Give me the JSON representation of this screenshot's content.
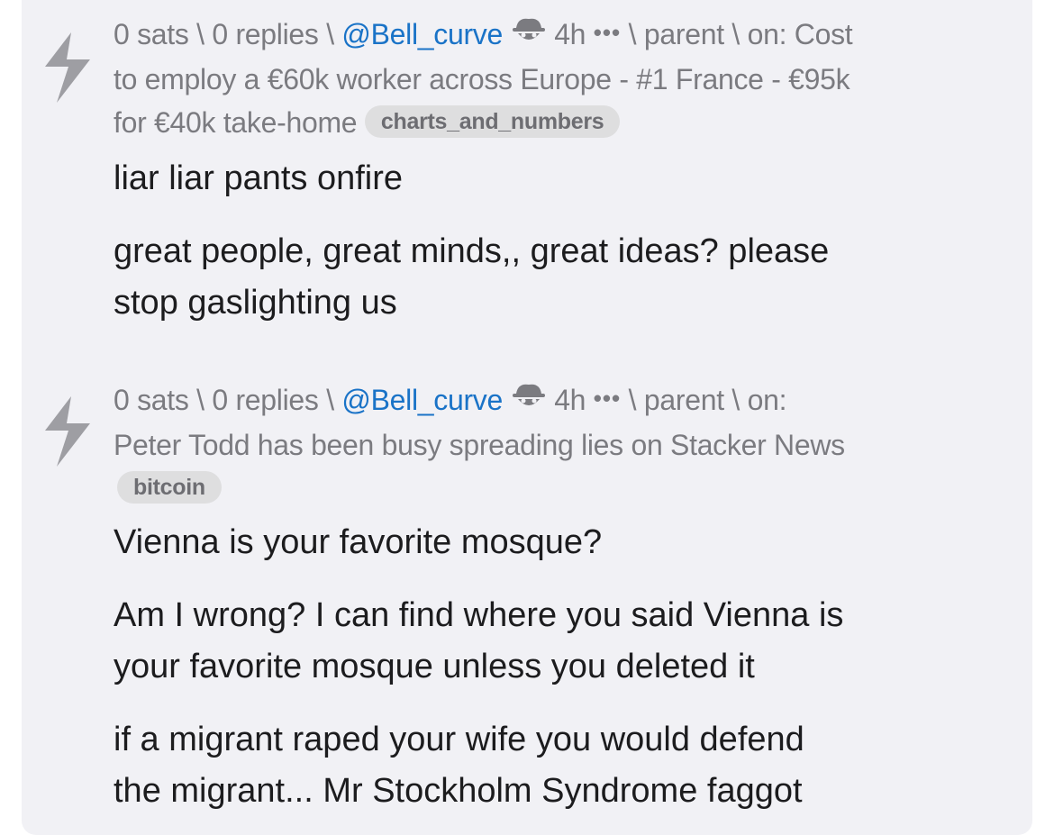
{
  "comments": [
    {
      "sats": "0 sats",
      "replies": "0 replies",
      "author": "@Bell_curve",
      "age": "4h",
      "more": "•••",
      "parent": "parent",
      "on_prefix": "on:",
      "title_line1": "Cost",
      "title_line2": "to employ a €60k worker across Europe - #1 France - €95k",
      "title_line3": "for €40k take-home",
      "tag": "charts_and_numbers",
      "paragraphs": [
        "liar liar pants onfire",
        "great people, great minds,, great ideas?  please",
        "stop gaslighting us"
      ]
    },
    {
      "sats": "0 sats",
      "replies": "0 replies",
      "author": "@Bell_curve",
      "age": "4h",
      "more": "•••",
      "parent": "parent",
      "on_prefix": "on:",
      "title": "Peter Todd has been busy spreading lies on Stacker News",
      "tag": "bitcoin",
      "paragraphs": [
        "Vienna is your favorite mosque?",
        "Am I wrong?  I can find where you said Vienna is",
        "your favorite mosque unless you deleted it",
        "if a migrant raped your wife you would defend",
        "the migrant... Mr Stockholm Syndrome faggot"
      ]
    }
  ],
  "icons": {
    "zap": "lightning-bolt-icon",
    "hat": "anon-hat-icon",
    "more": "ellipsis-icon"
  },
  "colors": {
    "card_bg": "#f1f1f5",
    "link": "#1a73c7",
    "meta": "#7b7b80",
    "tag_bg": "#dededf",
    "text": "#1c1c1e"
  }
}
